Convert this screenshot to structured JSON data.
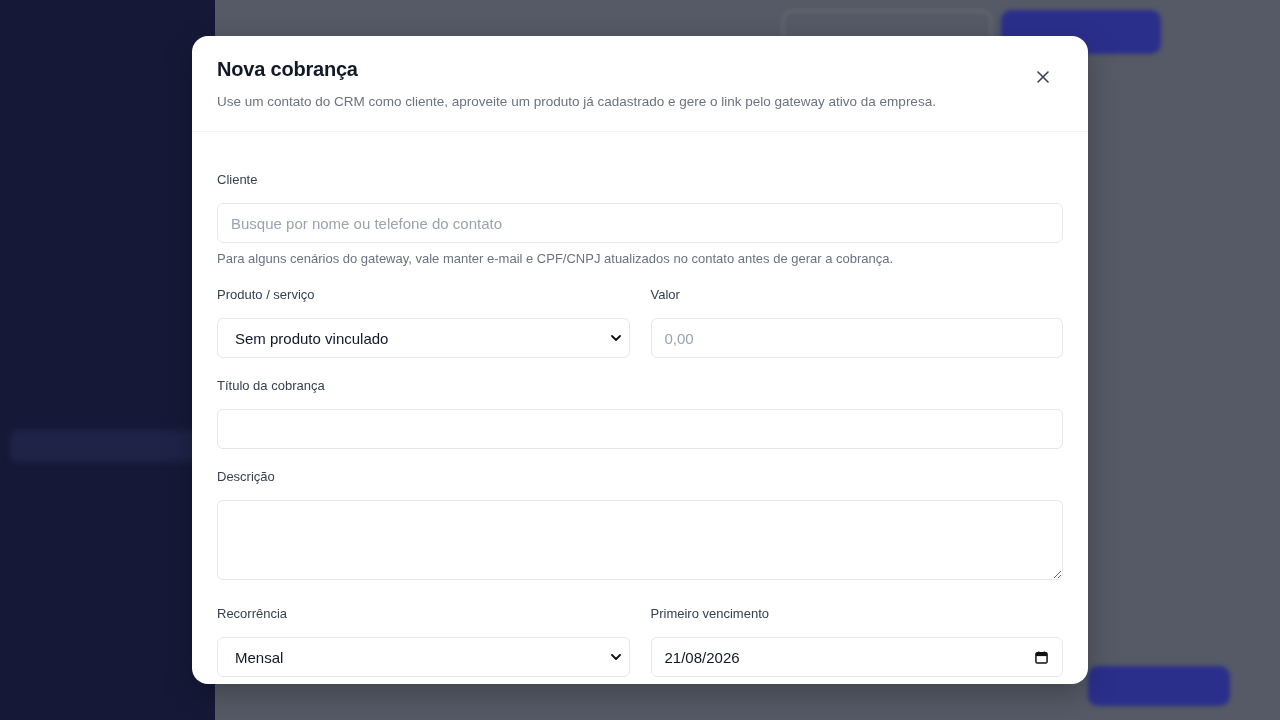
{
  "modal": {
    "title": "Nova cobrança",
    "subtitle": "Use um contato do CRM como cliente, aproveite um produto já cadastrado e gere o link pelo gateway ativo da empresa.",
    "rows": [
      {
        "fields": [
          {
            "kind": "text",
            "label": "Cliente",
            "placeholder": "Busque por nome ou telefone do contato",
            "hint": "Para alguns cenários do gateway, vale manter e-mail e CPF/CNPJ atualizados no contato antes de gerar a cobrança."
          }
        ]
      },
      {
        "fields": [
          {
            "kind": "select",
            "label": "Produto / serviço",
            "value": "Sem produto vinculado"
          },
          {
            "kind": "text",
            "label": "Valor",
            "placeholder": "0,00"
          }
        ]
      },
      {
        "fields": [
          {
            "kind": "text",
            "label": "Título da cobrança"
          }
        ]
      },
      {
        "fields": [
          {
            "kind": "textarea",
            "label": "Descrição"
          }
        ]
      },
      {
        "fields": [
          {
            "kind": "select",
            "label": "Recorrência",
            "value": "Mensal"
          },
          {
            "kind": "date",
            "label": "Primeiro vencimento",
            "value": "21/08/2026"
          }
        ]
      }
    ]
  }
}
